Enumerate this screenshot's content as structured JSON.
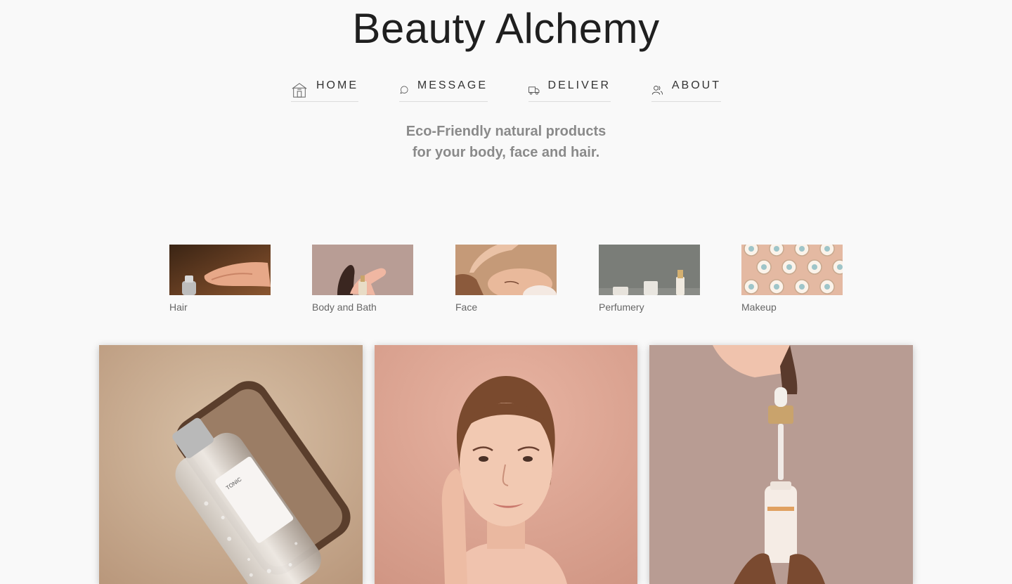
{
  "site": {
    "title": "Beauty Alchemy"
  },
  "nav": {
    "items": [
      {
        "label": "HOME",
        "icon": "home-icon"
      },
      {
        "label": "MESSAGE",
        "icon": "chat-bubble-icon"
      },
      {
        "label": "DELIVER",
        "icon": "truck-icon"
      },
      {
        "label": "ABOUT",
        "icon": "users-icon"
      }
    ]
  },
  "tagline": {
    "line1": "Eco-Friendly natural products",
    "line2": "for your body, face and hair."
  },
  "categories": [
    {
      "label": "Hair"
    },
    {
      "label": "Body and Bath"
    },
    {
      "label": "Face"
    },
    {
      "label": "Perfumery"
    },
    {
      "label": "Makeup"
    }
  ],
  "products": [
    {
      "name": "tonic-bottle-photo",
      "label": "TONIC"
    },
    {
      "name": "woman-portrait-photo"
    },
    {
      "name": "serum-dropper-photo"
    }
  ],
  "colors": {
    "background": "#f9f9f9",
    "title": "#1f1f1f",
    "tagline": "#8a8a8a",
    "nav_text": "#333333"
  }
}
